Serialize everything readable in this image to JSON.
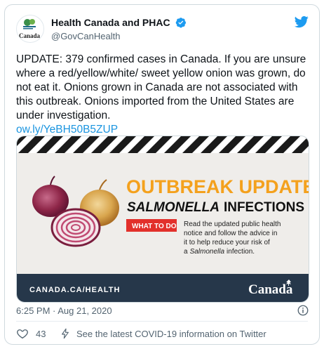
{
  "account": {
    "display_name": "Health Canada and PHAC",
    "handle": "@GovCanHealth",
    "avatar_text": "Canada"
  },
  "tweet": {
    "text": "UPDATE: 379 confirmed cases in Canada. If you are unsure where a red/yellow/white/ sweet yellow onion was grown, do not eat it. Onions grown in Canada are not associated with this outbreak. Onions imported from the United States are under investigation.",
    "link": "ow.ly/YeBH50B5ZUP",
    "timestamp": "6:25 PM · Aug 21, 2020"
  },
  "media": {
    "heading": "OUTBREAK UPDATE",
    "subheading_italic": "SALMONELLA",
    "subheading_rest": "INFECTIONS",
    "tag": "WHAT TO DO",
    "body_line_1": "Read the updated public health",
    "body_line_2": "notice and follow the advice in",
    "body_line_3": "it to help reduce your risk of",
    "body_line_4_prefix": "a",
    "body_line_4_italic": "Salmonella",
    "body_line_4_suffix": "infection.",
    "footer_url": "CANADA.CA/HEALTH",
    "footer_wordmark": "Canada"
  },
  "footer": {
    "likes": "43",
    "covid_text": "See the latest COVID-19 information on Twitter"
  },
  "colors": {
    "orange": "#f4a11d",
    "red_tag": "#e2302b",
    "navy": "#26374a",
    "link": "#1b95e0"
  }
}
